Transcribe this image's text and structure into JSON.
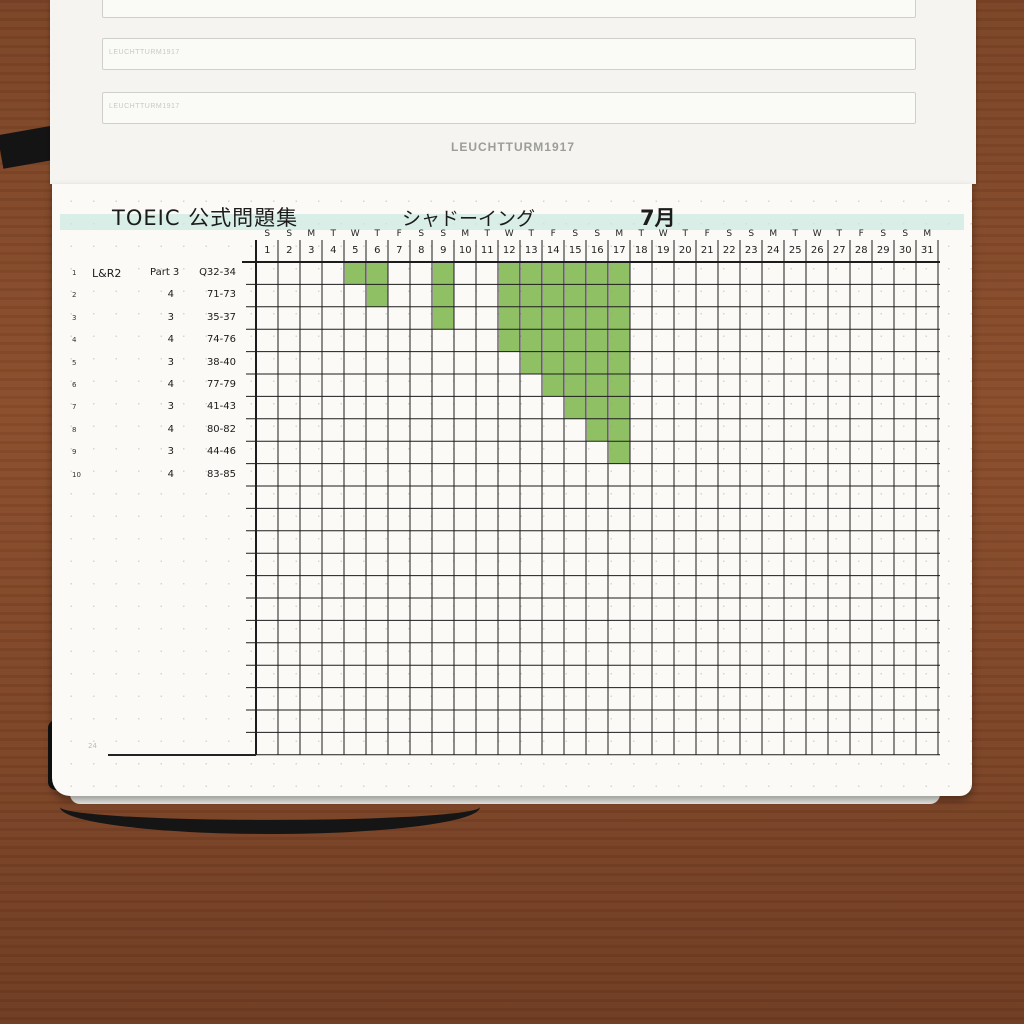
{
  "top_page": {
    "box_labels": [
      "LEUCHTTURM1917",
      "LEUCHTTURM1917",
      "LEUCHTTURM1917"
    ],
    "brand": "LEUCHTTURM1917"
  },
  "header": {
    "title": "TOEIC 公式問題集",
    "subtitle": "シャドーイング",
    "month": "7月"
  },
  "colors": {
    "ink": "#1c1c1c",
    "highlight": "#7db54a",
    "paper": "#fbfaf7",
    "wood": "#7e4527"
  },
  "weekdays": [
    "S",
    "S",
    "M",
    "T",
    "W",
    "T",
    "F",
    "S",
    "S",
    "M",
    "T",
    "W",
    "T",
    "F",
    "S",
    "S",
    "M",
    "T",
    "W",
    "T",
    "F",
    "S",
    "S",
    "M",
    "T",
    "W",
    "T",
    "F",
    "S",
    "S",
    "M"
  ],
  "days": [
    "1",
    "2",
    "3",
    "4",
    "5",
    "6",
    "7",
    "8",
    "9",
    "10",
    "11",
    "12",
    "13",
    "14",
    "15",
    "16",
    "17",
    "18",
    "19",
    "20",
    "21",
    "22",
    "23",
    "24",
    "25",
    "26",
    "27",
    "28",
    "29",
    "30",
    "31"
  ],
  "rows": [
    {
      "num": "1",
      "section": "L&R2",
      "part": "Part 3",
      "questions": "Q32-34"
    },
    {
      "num": "2",
      "section": "",
      "part": "4",
      "questions": "71-73"
    },
    {
      "num": "3",
      "section": "",
      "part": "3",
      "questions": "35-37"
    },
    {
      "num": "4",
      "section": "",
      "part": "4",
      "questions": "74-76"
    },
    {
      "num": "5",
      "section": "",
      "part": "3",
      "questions": "38-40"
    },
    {
      "num": "6",
      "section": "",
      "part": "4",
      "questions": "77-79"
    },
    {
      "num": "7",
      "section": "",
      "part": "3",
      "questions": "41-43"
    },
    {
      "num": "8",
      "section": "",
      "part": "4",
      "questions": "80-82"
    },
    {
      "num": "9",
      "section": "",
      "part": "3",
      "questions": "44-46"
    },
    {
      "num": "10",
      "section": "",
      "part": "4",
      "questions": "83-85"
    }
  ],
  "grid_size": {
    "columns": 31,
    "rows": 22
  },
  "completed_rows_by_day": [
    {
      "day": 5,
      "rows": 1
    },
    {
      "day": 6,
      "rows": 2
    },
    {
      "day": 9,
      "rows": 3
    },
    {
      "day": 12,
      "rows": 4
    },
    {
      "day": 13,
      "rows": 5
    },
    {
      "day": 14,
      "rows": 6
    },
    {
      "day": 15,
      "rows": 7
    },
    {
      "day": 16,
      "rows": 8
    },
    {
      "day": 17,
      "rows": 9
    }
  ],
  "page_number": "24"
}
